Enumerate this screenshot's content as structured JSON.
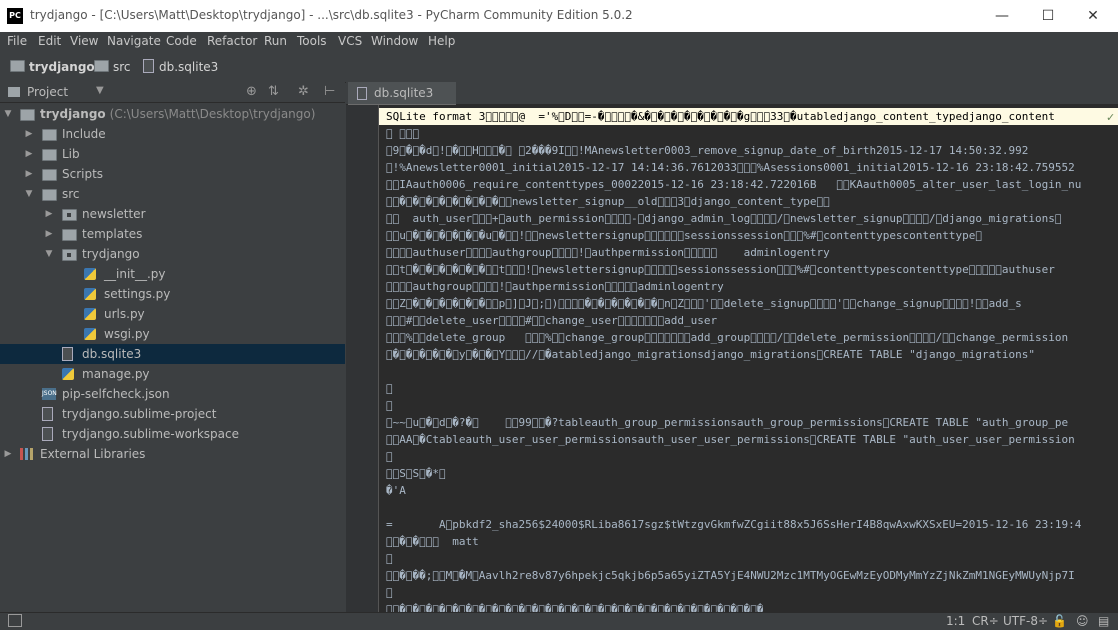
{
  "window": {
    "title": "trydjango - [C:\\Users\\Matt\\Desktop\\trydjango] - ...\\src\\db.sqlite3 - PyCharm Community Edition 5.0.2",
    "app_icon_text": "PC",
    "controls": {
      "minimize": "—",
      "maximize": "☐",
      "close": "✕"
    }
  },
  "menu": [
    "File",
    "Edit",
    "View",
    "Navigate",
    "Code",
    "Refactor",
    "Run",
    "Tools",
    "VCS",
    "Window",
    "Help"
  ],
  "breadcrumb": [
    "trydjango",
    "src",
    "db.sqlite3"
  ],
  "toolbar": {
    "dropdown": "▼",
    "run": "▶",
    "debug": "✹",
    "search": "⌕"
  },
  "project_panel": {
    "title": "Project",
    "dropdown": "▼",
    "actions": [
      "⊕",
      "⇅",
      "✲",
      "⊢"
    ],
    "tree": [
      {
        "label": "trydjango",
        "path": "(C:\\Users\\Matt\\Desktop\\trydjango)",
        "icon": "folder-icon",
        "arrow": "▼",
        "depth": 0
      },
      {
        "label": "Include",
        "icon": "folder-icon",
        "arrow": "▶",
        "depth": 1
      },
      {
        "label": "Lib",
        "icon": "folder-icon",
        "arrow": "▶",
        "depth": 1
      },
      {
        "label": "Scripts",
        "icon": "folder-icon",
        "arrow": "▶",
        "depth": 1
      },
      {
        "label": "src",
        "icon": "folder-icon",
        "arrow": "▼",
        "depth": 1
      },
      {
        "label": "newsletter",
        "icon": "package-icon",
        "arrow": "▶",
        "depth": 2
      },
      {
        "label": "templates",
        "icon": "folder-icon",
        "arrow": "▶",
        "depth": 2
      },
      {
        "label": "trydjango",
        "icon": "package-icon",
        "arrow": "▼",
        "depth": 2
      },
      {
        "label": "__init__.py",
        "icon": "python-file-icon",
        "arrow": "",
        "depth": 3
      },
      {
        "label": "settings.py",
        "icon": "python-file-icon",
        "arrow": "",
        "depth": 3
      },
      {
        "label": "urls.py",
        "icon": "python-file-icon",
        "arrow": "",
        "depth": 3
      },
      {
        "label": "wsgi.py",
        "icon": "python-file-icon",
        "arrow": "",
        "depth": 3
      },
      {
        "label": "db.sqlite3",
        "icon": "database-file-icon",
        "arrow": "",
        "depth": 2,
        "selected": true
      },
      {
        "label": "manage.py",
        "icon": "python-file-icon",
        "arrow": "",
        "depth": 2
      },
      {
        "label": "pip-selfcheck.json",
        "icon": "json-file-icon",
        "arrow": "",
        "depth": 1
      },
      {
        "label": "trydjango.sublime-project",
        "icon": "text-file-icon",
        "arrow": "",
        "depth": 1
      },
      {
        "label": "trydjango.sublime-workspace",
        "icon": "text-file-icon",
        "arrow": "",
        "depth": 1
      },
      {
        "label": "External Libraries",
        "icon": "library-icon",
        "arrow": "▶",
        "depth": 0
      }
    ]
  },
  "editor": {
    "tab": "db.sqlite3",
    "check": "✓",
    "lines": [
      "SQLite format 3\u0000\u0010\u0000\u0001\u0001@  ='%\u0000D\u0000\u0000=-�\u0000\u0000\u0000\u0000�&�\u0000�\u0000�\u0000�\u0000�\u0000�\u0000�\u0000�g\u0000\u0000\u000033\u0000�utabledjango_content_typedjango_content",
      "\u0000 \u0000\u0000\u0000",
      "\u00009\u0000�\u0000�d\u0000!\u0000�\u0000\u0000H\u0000\u0000\u0000�\u0000 \u00002���9I\u0000\u0000!MAnewsletter0003_remove_signup_date_of_birth2015-12-17 14:50:32.992",
      "\u0000!%Anewsletter0001_initial2015-12-17 14:14:36.7612033\u0000\u0000\u0000%Asessions0001_initial2015-12-16 23:18:42.759552",
      "\u0000\u0000IAauth0006_require_contenttypes_00022015-12-16 23:18:42.722016B   \u0000\u0000KAauth0005_alter_user_last_login_nu",
      "\u0000\u0000�\u0000�\u0000�\u0000�\u0000�\u0000�\u0000�\u0000�\u0000\u0000newsletter_signup__old\u0000\u0000\u00003\u0000django_content_type\u0000\u0000",
      "\u0000\u0000  auth_user\u0000\u0000\u0000+\u0000auth_permission\u0000\u0000\u0000\u0000-\u0000django_admin_log\u0000\u0000\u0000\u0000/\u0000newsletter_signup\u0000\u0000\u0000\u0000/\u0000django_migrations\u0000",
      "\u0000\u0000u\u0000�\u0000�\u0000�\u0000�\u0000�\u0000�u\u0000�\u0000\u0000!\u0000\u0000newslettersignup\u0000\u0000\u0000\u0000\u0000\u0000sessionssession\u0000\u0000\u0000%#\u0000contenttypescontenttype\u0000",
      "\u0000\u0000\u0000\u0000authuser\u0000\u0000\u0000\u0000authgroup\u0000\u0000\u0000\u0000!\u0000authpermission\u0000\u0000\u0000\u0000\u0000    adminlogentry",
      "\u0000\u0000t\u0000�\u0000�\u0000�\u0000�\u0000�\u0000�\u0000\u0000t\u0000\u0000\u0000!\u0000newslettersignup\u0000\u0000\u0000\u0000\u0000sessionssession\u0000\u0000\u0000%#\u0000contenttypescontenttype\u0000\u0000\u0000\u0000\u0000authuser",
      "\u0000\u0000\u0000\u0000authgroup\u0000\u0000\u0000\u0000!\u0000authpermission\u0000\u0000\u0000\u0000\u0000adminlogentry",
      "\u0000\u0000Z\u0000�\u0000�\u0000�\u0000�\u0000�\u0000�\u0000\u0000p\u0000]\u0000J\u0000;\u0000)\u0000\u0000\u0000\u0000�\u0000�\u0000�\u0000�\u0000�\u0000�\u0000n\u0000Z\u0000\u0000\u0000'\u0000\u0000delete_signup\u0000\u0000\u0000\u0000'\u0000\u0000change_signup\u0000\u0000\u0000\u0000!\u0000\u0000add_s",
      "\u0000\u0000\u0000#\u0000\u0000delete_user\u0000\u0000\u0000\u0000#\u0000\u0000change_user\u0000\u0000\u0000\u0000\u0000\u0000\u0000add_user",
      "\u0000\u0000\u0000%\u0000\u0000delete_group   \u0000\u0000\u0000%\u0000\u0000change_group\u0000\u0000\u0000\u0000\u0000\u0000\u0000add_group\u0000\u0000\u0000\u0000/\u0000\u0000delete_permission\u0000\u0000\u0000\u0000/\u0000\u0000change_permission",
      "\u0000�\u0000�\u0000�\u0000�\u0000�\u0000y\u0000�\u0000�\u0000Y\u0000\u0000\u0000//\u0000�atabledjango_migrationsdjango_migrations\u0000CREATE TABLE \"django_migrations\"",
      "",
      "\u0000",
      "\u0000",
      "\u0000~~\u0000u\u0000�\u0000d\u0000�?�\u0000    \u0000\u000099\u0000\u0000�?tableauth_group_permissionsauth_group_permissions\u0000CREATE TABLE \"auth_group_pe",
      "\u0000\u0000AA\u0000�Ctableauth_user_user_permissionsauth_user_user_permissions\u0000CREATE TABLE \"auth_user_user_permission",
      "\u0000",
      "\u0000\u0000S\u0000S\u0000�*\u0000",
      "�'A",
      "",
      "=       A\u0000pbkdf2_sha256$24000$RLiba8617sgz$tWtzgvGkmfwZCgiit88x5J6SsHerI4B8qwAxwKXSxEU=2015-12-16 23:19:4",
      "\u0000\u0000�\u0000�\u0000\u0000\u0000  matt",
      "\u0000",
      "\u0000\u0000�\u0000��;\u0000\u0000M\u0000�M\u0000Aavlh2re8v87y6hpekjc5qkjb6p5a65yiZTA5YjE4NWU2Mzc1MTMyOGEwMzEyODMyMmYzZjNkZmM1NGEyMWUyNjp7I",
      "\u0000",
      "\u0000\u0000�\u0000�\u0000�\u0000�\u0000�\u0000�\u0000�\u0000�\u0000�\u0000�\u0000�\u0000�\u0000�\u0000�\u0000�\u0000�\u0000�\u0000�\u0000�\u0000�\u0000�\u0000�\u0000�\u0000�\u0000�\u0000�\u0000�\u0000�"
    ]
  },
  "status": {
    "position": "1:1",
    "line_sep": "CR÷",
    "encoding": "UTF-8÷"
  }
}
